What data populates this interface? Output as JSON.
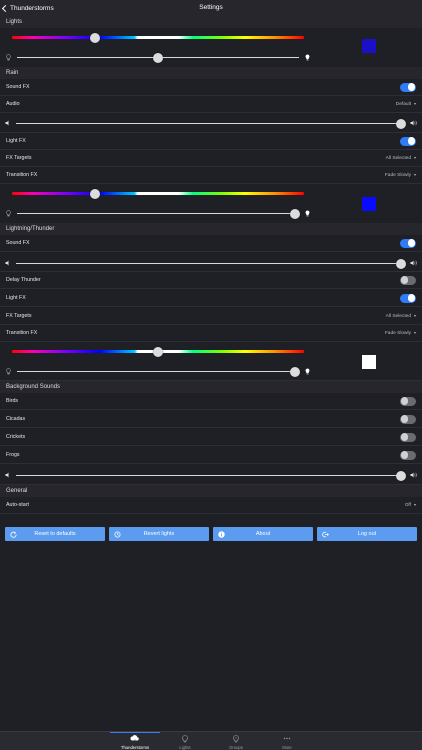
{
  "nav": {
    "back_label": "Thunderstorms",
    "title": "Settings"
  },
  "sections": {
    "lights": "Lights",
    "rain": "Rain",
    "lightning": "Lightning/Thunder",
    "background": "Background Sounds",
    "general": "General"
  },
  "lights": {
    "hue_level": 0.32,
    "brightness_level": 0.5,
    "swatch_color": "#1a10c8"
  },
  "rain": {
    "sound_fx": {
      "label": "Sound FX",
      "on": true
    },
    "audio": {
      "label": "Audio",
      "value": "Default"
    },
    "volume_level": 0.98,
    "light_fx": {
      "label": "Light FX",
      "on": true
    },
    "fx_targets": {
      "label": "FX Targets",
      "value": "All Selected"
    },
    "transition_fx": {
      "label": "Transition FX",
      "value": "Fade Slowly"
    },
    "hue_level": 0.28,
    "brightness_level": 1.0,
    "swatch_color": "#0a0aff"
  },
  "lightning": {
    "sound_fx": {
      "label": "Sound FX",
      "on": true
    },
    "volume_level": 0.98,
    "delay_thunder": {
      "label": "Delay Thunder",
      "on": false
    },
    "light_fx": {
      "label": "Light FX",
      "on": true
    },
    "fx_targets": {
      "label": "FX Targets",
      "value": "All Selected"
    },
    "transition_fx": {
      "label": "Transition FX",
      "value": "Fade Slowly"
    },
    "hue_level": 0.5,
    "brightness_level": 1.0,
    "swatch_color": "#ffffff"
  },
  "background": {
    "birds": {
      "label": "Birds",
      "on": false
    },
    "cicadas": {
      "label": "Cicadas",
      "on": false
    },
    "crickets": {
      "label": "Crickets",
      "on": false
    },
    "frogs": {
      "label": "Frogs",
      "on": false
    },
    "volume_level": 0.98
  },
  "general": {
    "auto_start": {
      "label": "Auto-start",
      "value": "Off"
    }
  },
  "buttons": {
    "reset": "Reset to defaults",
    "revert": "Revert lights",
    "about": "About",
    "logout": "Log out"
  },
  "tabs": [
    {
      "label": "Thunderstorms",
      "icon": "cloud-lightning-icon",
      "active": true
    },
    {
      "label": "Lights",
      "icon": "bulb-icon",
      "active": false
    },
    {
      "label": "Groups",
      "icon": "bulb-group-icon",
      "active": false
    },
    {
      "label": "More",
      "icon": "more-icon",
      "active": false
    }
  ],
  "colors": {
    "accent": "#2f7cf6",
    "button": "#5b9cf0",
    "background": "#1f1f26",
    "header": "#26262c"
  }
}
